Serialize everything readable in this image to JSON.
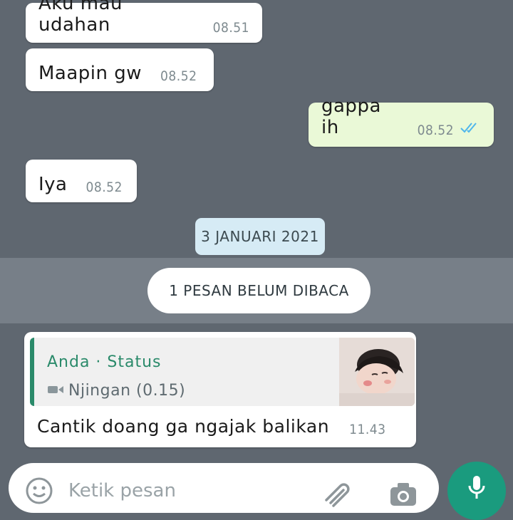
{
  "messages": [
    {
      "text": "Aku mau udahan",
      "time": "08.51",
      "direction": "in"
    },
    {
      "text": "Maapin gw",
      "time": "08.52",
      "direction": "in"
    },
    {
      "text": "gappa ih",
      "time": "08.52",
      "direction": "out",
      "status": "read-double-check"
    },
    {
      "text": "Iya",
      "time": "08.52",
      "direction": "in"
    }
  ],
  "date_separator": "3 JANUARI 2021",
  "unread_banner": "1 PESAN BELUM DIBACA",
  "reply_message": {
    "quoted": {
      "author": "Anda · Status",
      "media_icon": "video-camera-icon",
      "text": "Njingan (0.15)",
      "thumbnail": "status-thumbnail"
    },
    "text": "Cantik doang ga ngajak balikan",
    "time": "11.43"
  },
  "composer": {
    "placeholder": "Ketik pesan",
    "icons": [
      "emoji-icon",
      "attachment-icon",
      "camera-icon",
      "microphone-icon"
    ]
  },
  "colors": {
    "chat_background": "#5f6770",
    "incoming_bubble": "#ffffff",
    "outgoing_bubble": "#eaf9d7",
    "date_chip": "#d6ebf5",
    "accent_green": "#1a9b7e",
    "quote_author": "#2a8a6a",
    "read_ticks": "#4fb6ec"
  }
}
